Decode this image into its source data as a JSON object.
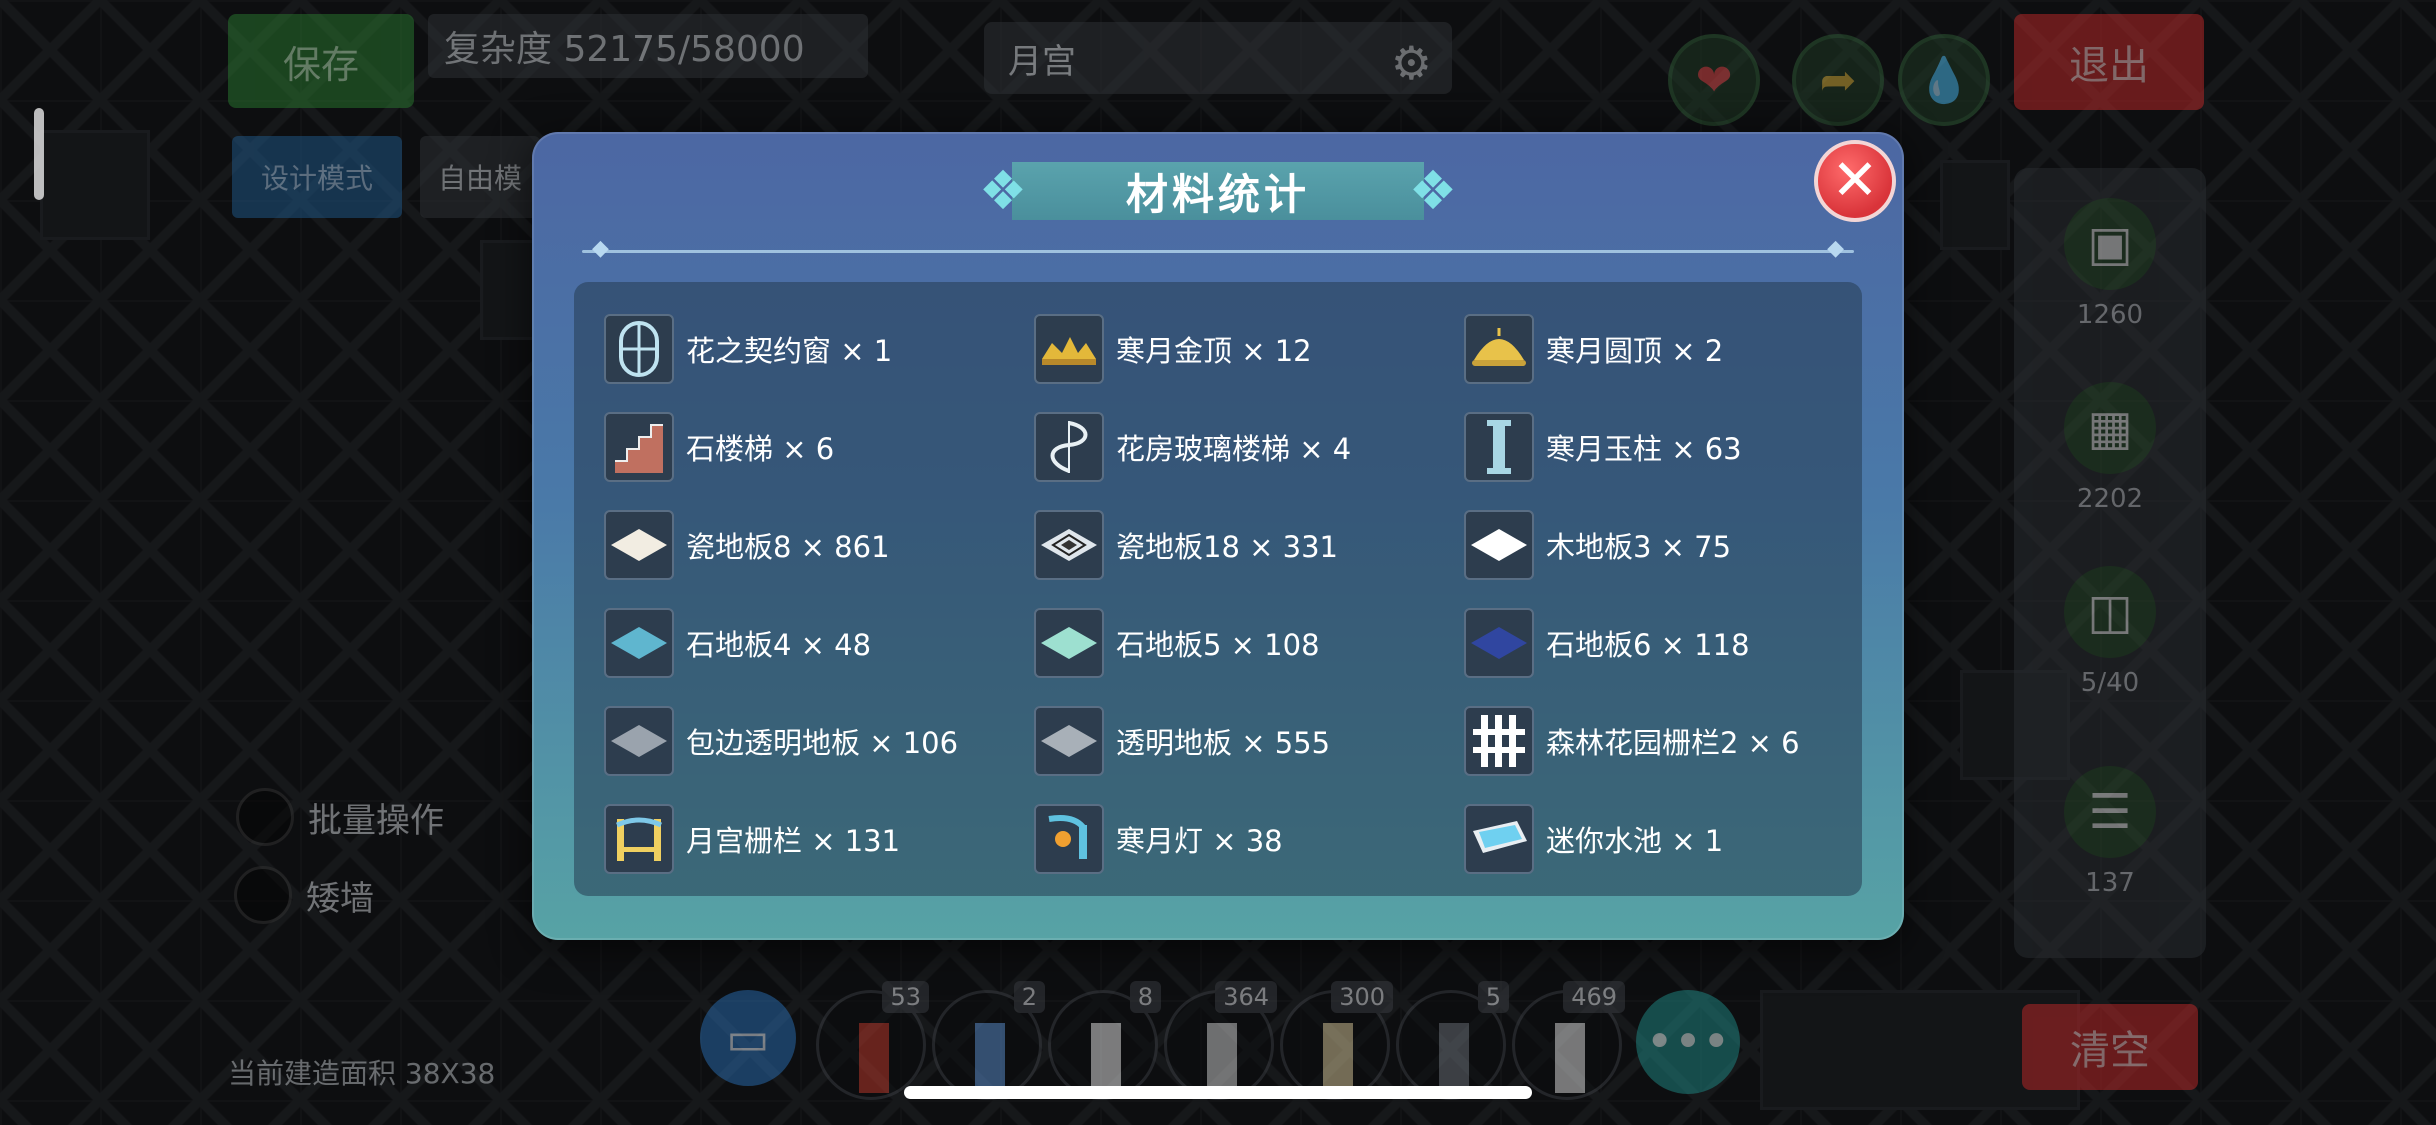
{
  "hud": {
    "save_label": "保存",
    "complexity_label": "复杂度 52175/58000",
    "design_mode_label": "设计模式",
    "free_mode_label": "自由模",
    "build_name": "月宫",
    "exit_label": "退出",
    "clear_label": "清空",
    "batch_label": "批量操作",
    "low_wall_label": "矮墙",
    "area_label": "当前建造面积 38X38",
    "side_counts": [
      "1260",
      "2202",
      "5/40",
      "137"
    ],
    "toolbar_counts": [
      "53",
      "2",
      "8",
      "364",
      "300",
      "5",
      "469"
    ],
    "more_label": "•••"
  },
  "modal": {
    "title": "材料统计",
    "close_icon": "close-icon",
    "items": [
      {
        "label": "花之契约窗 × 1",
        "icon": "window-icon",
        "color": "#bfe3f0"
      },
      {
        "label": "寒月金顶 × 12",
        "icon": "gold-roof-icon",
        "color": "#e3b83a"
      },
      {
        "label": "寒月圆顶 × 2",
        "icon": "dome-icon",
        "color": "#e8c24a"
      },
      {
        "label": "石楼梯 × 6",
        "icon": "stone-stairs-icon",
        "color": "#c07060"
      },
      {
        "label": "花房玻璃楼梯 × 4",
        "icon": "spiral-stairs-icon",
        "color": "#e8f0f4"
      },
      {
        "label": "寒月玉柱 × 63",
        "icon": "pillar-icon",
        "color": "#a8d6e4"
      },
      {
        "label": "瓷地板8 × 861",
        "icon": "tile-floor-icon",
        "color": "#f2ede2"
      },
      {
        "label": "瓷地板18 × 331",
        "icon": "pattern-floor-icon",
        "color": "#dfe6ec"
      },
      {
        "label": "木地板3 × 75",
        "icon": "wood-floor-icon",
        "color": "#ffffff"
      },
      {
        "label": "石地板4 × 48",
        "icon": "stone-floor-icon",
        "color": "#5fb6cf"
      },
      {
        "label": "石地板5 × 108",
        "icon": "stone-floor-icon",
        "color": "#9de0d0"
      },
      {
        "label": "石地板6 × 118",
        "icon": "stone-floor-icon",
        "color": "#3046a0"
      },
      {
        "label": "包边透明地板 × 106",
        "icon": "glass-floor-icon",
        "color": "#9aa3ad"
      },
      {
        "label": "透明地板 × 555",
        "icon": "glass-floor-icon",
        "color": "#a8b0b8"
      },
      {
        "label": "森林花园栅栏2 × 6",
        "icon": "fence-icon",
        "color": "#ffffff"
      },
      {
        "label": "月宫栅栏 × 131",
        "icon": "moon-fence-icon",
        "color": "#f0d060"
      },
      {
        "label": "寒月灯 × 38",
        "icon": "lamp-icon",
        "color": "#5fc2e0"
      },
      {
        "label": "迷你水池 × 1",
        "icon": "pool-icon",
        "color": "#6fd0f0"
      }
    ]
  }
}
